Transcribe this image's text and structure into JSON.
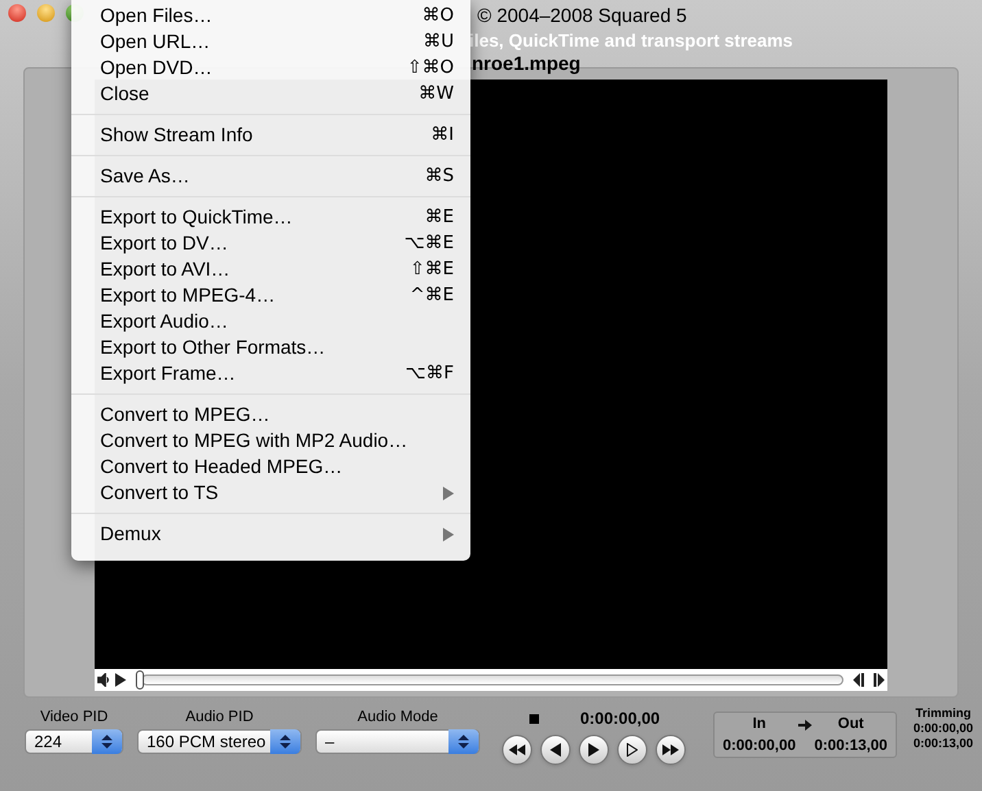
{
  "title_bar": {
    "copyright": "© 2004–2008 Squared 5",
    "subtitle": "iles, QuickTime and transport streams",
    "file_name": "nroe1.mpeg"
  },
  "menu": {
    "groups": [
      [
        {
          "label": "Open Files…",
          "shortcut": "⌘O",
          "kind": "command"
        },
        {
          "label": "Open URL…",
          "shortcut": "⌘U",
          "kind": "command"
        },
        {
          "label": "Open DVD…",
          "shortcut": "⇧⌘O",
          "kind": "command"
        },
        {
          "label": "Close",
          "shortcut": "⌘W",
          "kind": "command"
        }
      ],
      [
        {
          "label": "Show Stream Info",
          "shortcut": "⌘I",
          "kind": "command"
        }
      ],
      [
        {
          "label": "Save As…",
          "shortcut": "⌘S",
          "kind": "command"
        }
      ],
      [
        {
          "label": "Export to QuickTime…",
          "shortcut": "⌘E",
          "kind": "command"
        },
        {
          "label": "Export to DV…",
          "shortcut": "⌥⌘E",
          "kind": "command"
        },
        {
          "label": "Export to AVI…",
          "shortcut": "⇧⌘E",
          "kind": "command"
        },
        {
          "label": "Export to MPEG-4…",
          "shortcut": "^⌘E",
          "kind": "command"
        },
        {
          "label": "Export Audio…",
          "kind": "command"
        },
        {
          "label": "Export to Other Formats…",
          "kind": "command"
        },
        {
          "label": "Export Frame…",
          "shortcut": "⌥⌘F",
          "kind": "command"
        }
      ],
      [
        {
          "label": "Convert to MPEG…",
          "kind": "command"
        },
        {
          "label": "Convert to MPEG with MP2 Audio…",
          "kind": "command"
        },
        {
          "label": "Convert to Headed MPEG…",
          "kind": "command"
        },
        {
          "label": "Convert to TS",
          "kind": "submenu"
        }
      ],
      [
        {
          "label": "Demux",
          "kind": "submenu"
        }
      ]
    ]
  },
  "controls": {
    "selects": [
      {
        "label": "Video PID",
        "value": "224"
      },
      {
        "label": "Audio PID",
        "value": "160 PCM stereo"
      },
      {
        "label": "Audio Mode",
        "value": "–"
      }
    ],
    "time": "0:00:00,00",
    "in_out": {
      "in_label": "In",
      "out_label": "Out",
      "in_time": "0:00:00,00",
      "out_time": "0:00:13,00"
    },
    "trimming": {
      "label": "Trimming",
      "start": "0:00:00,00",
      "end": "0:00:13,00"
    }
  }
}
